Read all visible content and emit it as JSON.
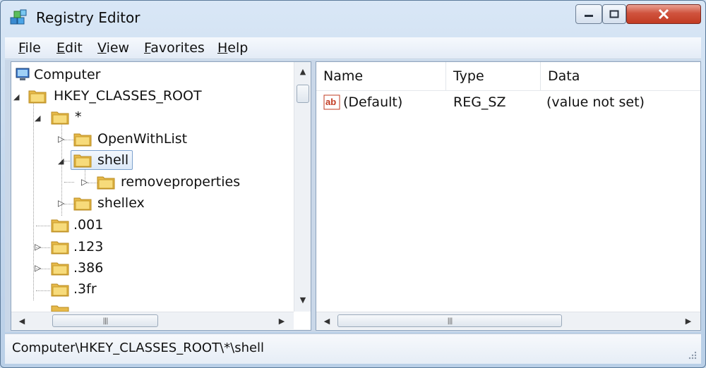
{
  "window": {
    "title": "Registry Editor"
  },
  "menu": [
    "File",
    "Edit",
    "View",
    "Favorites",
    "Help"
  ],
  "tree": {
    "root": "Computer",
    "hkcr": "HKEY_CLASSES_ROOT",
    "star": "*",
    "openwithlist": "OpenWithList",
    "shell": "shell",
    "removeproperties": "removeproperties",
    "shellex": "shellex",
    "k001": ".001",
    "k123": ".123",
    "k386": ".386",
    "k3fr": ".3fr"
  },
  "list": {
    "columns": [
      "Name",
      "Type",
      "Data"
    ],
    "rows": [
      {
        "name": "(Default)",
        "type": "REG_SZ",
        "data": "(value not set)",
        "icon": "string-value-icon"
      }
    ]
  },
  "status": {
    "path": "Computer\\HKEY_CLASSES_ROOT\\*\\shell"
  },
  "colors": {
    "accent": "#c23b22",
    "selection": "#dbe8f7",
    "frame": "#c6d9ee"
  }
}
